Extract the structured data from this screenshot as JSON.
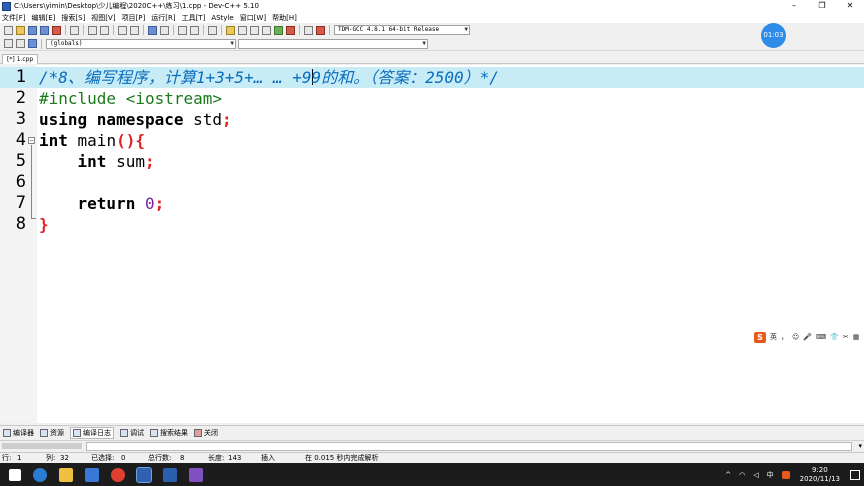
{
  "window": {
    "title": "C:\\Users\\yimin\\Desktop\\少儿编程\\2020C++\\练习\\1.cpp - Dev-C++ 5.10",
    "minimize": "–",
    "restore": "❐",
    "close": "✕"
  },
  "menu": [
    "文件[F]",
    "编辑[E]",
    "搜索[S]",
    "视图[V]",
    "项目[P]",
    "运行[R]",
    "工具[T]",
    "AStyle",
    "窗口[W]",
    "帮助[H]"
  ],
  "toolbar": {
    "compiler_select": "TDM-GCC 4.8.1 64-bit Release",
    "scope_select": "(globals)",
    "symbol_select": ""
  },
  "tabs": [
    {
      "label": "[*] 1.cpp"
    }
  ],
  "editor": {
    "line_numbers": [
      "1",
      "2",
      "3",
      "4",
      "5",
      "6",
      "7",
      "8"
    ],
    "line1": {
      "before_cursor": "/*8、编写程序，计算1+3+5+… … +9",
      "after_cursor": "9的和。（答案：2500）*/"
    },
    "line2": "#include <iostream>",
    "line3": {
      "kw": "using namespace",
      "ident": " std",
      "semi": ";"
    },
    "line4": {
      "kw": "int",
      "ident": " main",
      "paren": "(){"
    },
    "line5": {
      "indent": "    ",
      "kw": "int",
      "ident": " sum",
      "semi": ";"
    },
    "line6": "",
    "line7": {
      "indent": "    ",
      "kw": "return",
      "space": " ",
      "num": "0",
      "semi": ";"
    },
    "line8": {
      "brace": "}"
    }
  },
  "timer_badge": "01:03",
  "ime_bar": {
    "logo": "S",
    "lang": "英",
    "items": [
      "，",
      "☺",
      "🎤",
      "⌨",
      "👕",
      "✂",
      "▦"
    ]
  },
  "bottom_tabs": [
    "编译器",
    "资源",
    "编译日志",
    "调试",
    "搜索结果",
    "关闭"
  ],
  "status": {
    "row_label": "行:",
    "row": "1",
    "col_label": "列:",
    "col": "32",
    "sel_label": "已选择:",
    "sel": "0",
    "total_label": "总行数:",
    "total": "8",
    "len_label": "长度:",
    "len": "143",
    "mode": "插入",
    "message": "在 0.015 秒内完成解析"
  },
  "taskbar": {
    "tray_chevron": "^",
    "lang": "中",
    "time": "9:20",
    "date": "2020/11/13"
  }
}
